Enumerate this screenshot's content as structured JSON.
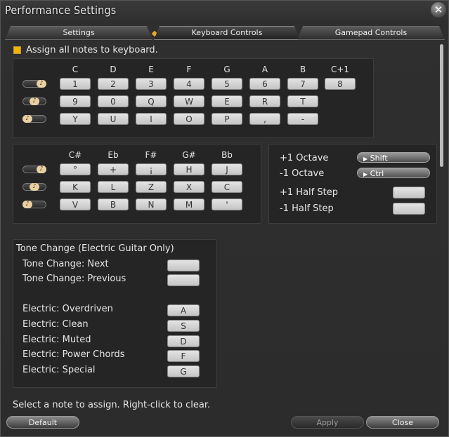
{
  "window": {
    "title": "Performance Settings"
  },
  "icons": {
    "close": "close-x-icon",
    "note": "music-note-icon",
    "arrow": "triangle-right-icon"
  },
  "colors": {
    "accent": "#f0b400",
    "key": "#d4d4d4"
  },
  "tabs": [
    {
      "label": "Settings",
      "active": false
    },
    {
      "label": "Keyboard Controls",
      "active": true
    },
    {
      "label": "Gamepad Controls",
      "active": false
    }
  ],
  "assign_all": {
    "label": "Assign all notes to keyboard.",
    "checked": true
  },
  "natural_notes": {
    "headers": [
      "C",
      "D",
      "E",
      "F",
      "G",
      "A",
      "B",
      "C+1"
    ],
    "rows": [
      [
        "1",
        "2",
        "3",
        "4",
        "5",
        "6",
        "7",
        "8"
      ],
      [
        "9",
        "0",
        "Q",
        "W",
        "E",
        "R",
        "T"
      ],
      [
        "Y",
        "U",
        "I",
        "O",
        "P",
        ",",
        "-"
      ]
    ]
  },
  "sharp_notes": {
    "headers": [
      "C#",
      "Eb",
      "F#",
      "G#",
      "Bb"
    ],
    "rows": [
      [
        "°",
        "+",
        "¡",
        "H",
        "J"
      ],
      [
        "K",
        "L",
        "Z",
        "X",
        "C"
      ],
      [
        "V",
        "B",
        "N",
        "M",
        "'"
      ]
    ]
  },
  "octave": {
    "up_label": "+1 Octave",
    "up_key": "Shift",
    "down_label": "-1 Octave",
    "down_key": "Ctrl",
    "half_up_label": "+1 Half Step",
    "half_down_label": "-1 Half Step"
  },
  "tone": {
    "title": "Tone Change (Electric Guitar Only)",
    "items": [
      {
        "label": "Tone Change: Next",
        "key": ""
      },
      {
        "label": "Tone Change: Previous",
        "key": ""
      },
      {
        "label": "Electric: Overdriven",
        "key": "A"
      },
      {
        "label": "Electric: Clean",
        "key": "S"
      },
      {
        "label": "Electric: Muted",
        "key": "D"
      },
      {
        "label": "Electric: Power Chords",
        "key": "F"
      },
      {
        "label": "Electric: Special",
        "key": "G"
      }
    ]
  },
  "status": "Select a note to assign. Right-click to clear.",
  "footer": {
    "default": "Default",
    "apply": "Apply",
    "close": "Close"
  }
}
